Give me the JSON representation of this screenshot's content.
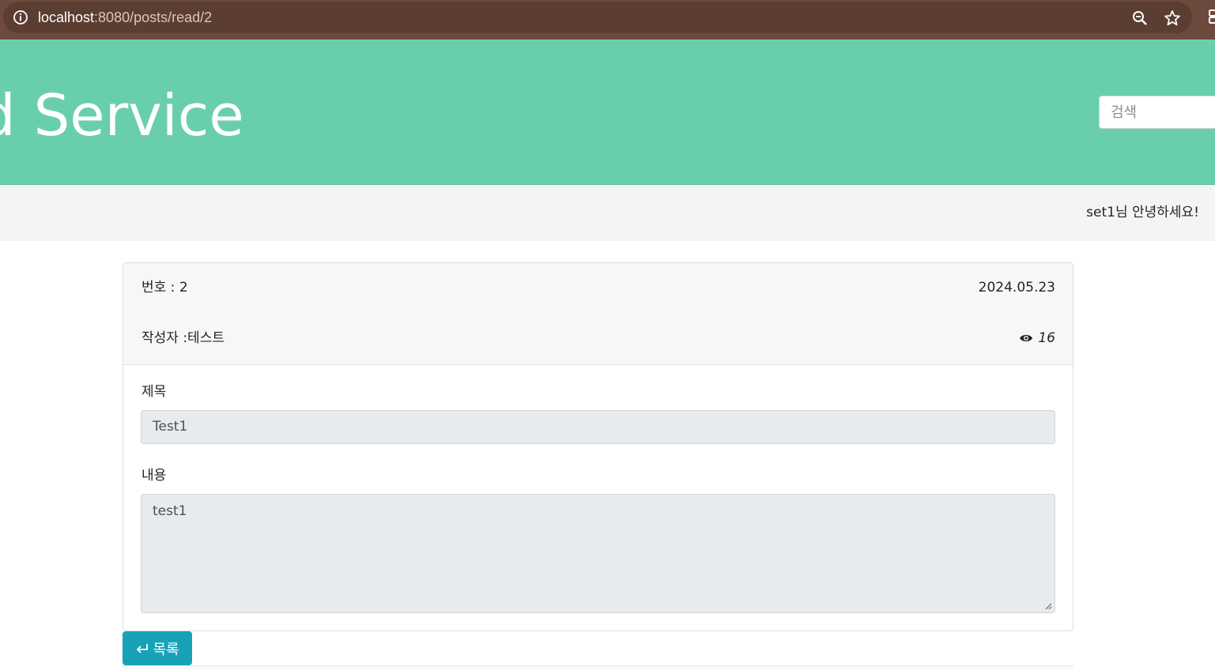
{
  "browser": {
    "url_host": "localhost",
    "url_path": ":8080/posts/read/2",
    "icons": [
      "info-icon",
      "zoom-icon",
      "star-icon"
    ]
  },
  "header": {
    "title": "d Service",
    "search_placeholder": "검색",
    "colors": {
      "banner": "#69cfab",
      "browser_bar": "#6d4a3e"
    }
  },
  "greeting": "set1님 안녕하세요!",
  "post": {
    "number_label": "번호 : 2",
    "date": "2024.05.23",
    "author_label": "작성자 :테스트",
    "views": "16",
    "title_label": "제목",
    "title_value": "Test1",
    "content_label": "내용",
    "content_value": "test1"
  },
  "actions": {
    "list_button_label": "목록",
    "list_button_color": "#17a2b8"
  }
}
